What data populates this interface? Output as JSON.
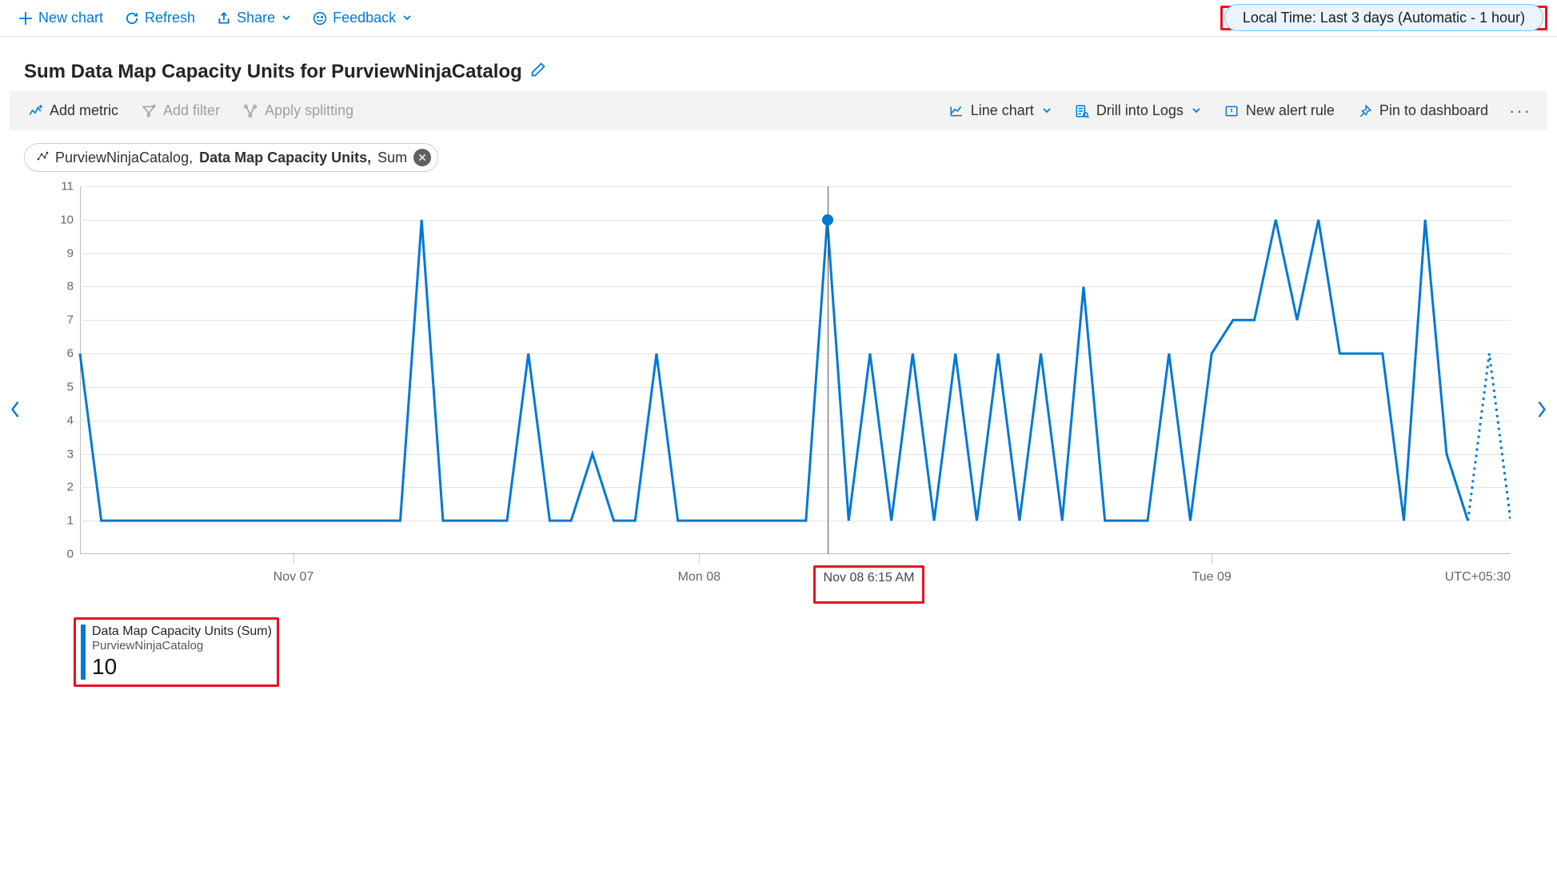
{
  "toolbar": {
    "new_chart": "New chart",
    "refresh": "Refresh",
    "share": "Share",
    "feedback": "Feedback",
    "time_range": "Local Time: Last 3 days (Automatic - 1 hour)"
  },
  "chart_title": "Sum Data Map Capacity Units for PurviewNinjaCatalog",
  "grey_toolbar": {
    "add_metric": "Add metric",
    "add_filter": "Add filter",
    "apply_splitting": "Apply splitting",
    "chart_type": "Line chart",
    "drill_logs": "Drill into Logs",
    "new_alert": "New alert rule",
    "pin_dashboard": "Pin to dashboard"
  },
  "metric_chip": {
    "resource": "PurviewNinjaCatalog,",
    "metric_bold": "Data Map Capacity Units,",
    "aggregation": "Sum"
  },
  "axes": {
    "y_ticks": [
      "0",
      "1",
      "2",
      "3",
      "4",
      "5",
      "6",
      "7",
      "8",
      "9",
      "10",
      "11"
    ],
    "x_labels": {
      "nov07": "Nov 07",
      "mon08": "Mon 08",
      "tue09": "Tue 09"
    },
    "utc": "UTC+05:30"
  },
  "hover": {
    "time_label": "Nov 08 6:15 AM",
    "series_index": 35,
    "value": 10
  },
  "legend": {
    "line1": "Data Map Capacity Units (Sum)",
    "line2": "PurviewNinjaCatalog",
    "value": "10"
  },
  "chart_data": {
    "type": "line",
    "title": "Sum Data Map Capacity Units for PurviewNinjaCatalog",
    "ylabel": "",
    "xlabel": "",
    "ylim": [
      0,
      11
    ],
    "x_major_labels": [
      "Nov 07",
      "Mon 08",
      "Tue 09"
    ],
    "x_minor_interval": "1 hour",
    "x_range_hours": 72,
    "series": [
      {
        "name": "Data Map Capacity Units (Sum) — PurviewNinjaCatalog",
        "color": "#0078d4",
        "values": [
          6,
          1,
          1,
          1,
          1,
          1,
          1,
          1,
          1,
          1,
          1,
          1,
          1,
          1,
          1,
          1,
          10,
          1,
          1,
          1,
          1,
          6,
          1,
          1,
          3,
          1,
          1,
          6,
          1,
          1,
          1,
          1,
          1,
          1,
          1,
          10,
          1,
          6,
          1,
          6,
          1,
          6,
          1,
          6,
          1,
          6,
          1,
          8,
          1,
          1,
          1,
          6,
          1,
          6,
          7,
          7,
          10,
          7,
          10,
          6,
          6,
          6,
          1,
          10,
          3,
          1,
          6,
          1
        ]
      }
    ],
    "dashed_trailing_points": 3
  }
}
